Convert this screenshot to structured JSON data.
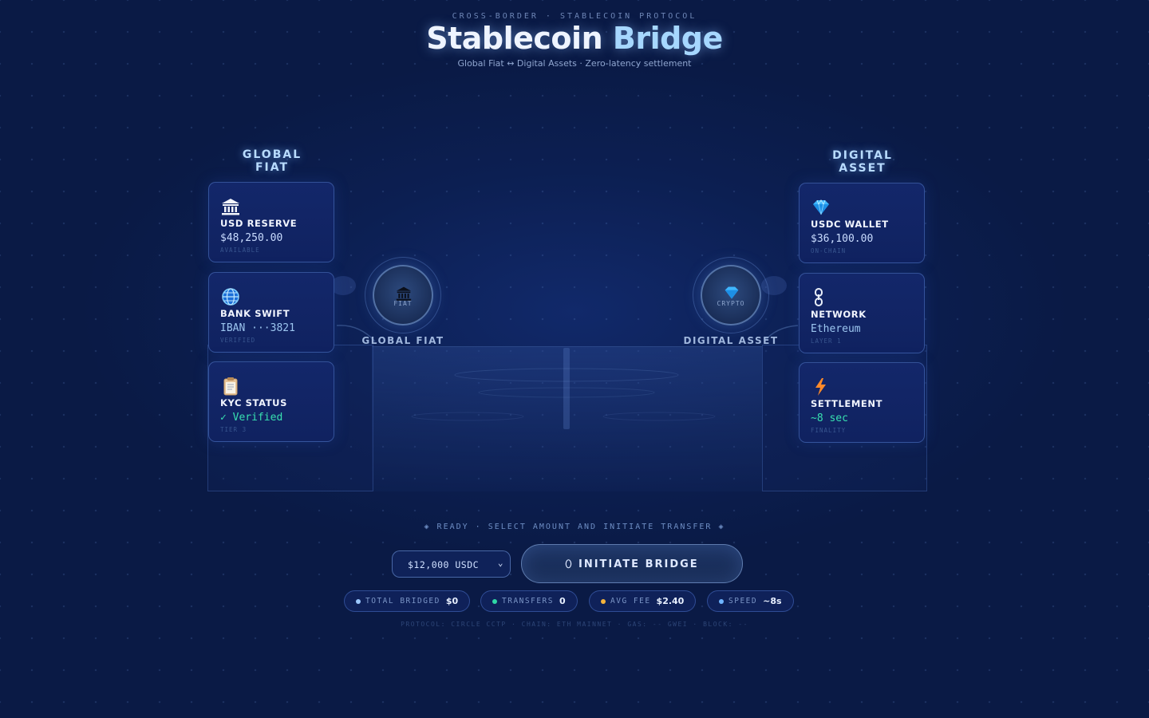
{
  "header": {
    "kicker": "CROSS-BORDER · STABLECOIN PROTOCOL",
    "title_main": "Stablecoin",
    "title_accent": "Bridge",
    "subtitle": "Global Fiat ↔ Digital Assets · Zero-latency settlement"
  },
  "fiat": {
    "heading_line1": "GLOBAL",
    "heading_line2": "FIAT",
    "cards": [
      {
        "icon": "bank-icon",
        "label": "USD RESERVE",
        "value": "$48,250.00",
        "sub": "AVAILABLE"
      },
      {
        "icon": "globe-icon",
        "label": "BANK SWIFT",
        "value": "IBAN ···3821",
        "sub": "VERIFIED"
      },
      {
        "icon": "clipboard-icon",
        "label": "KYC STATUS",
        "value": "✓ Verified",
        "sub": "TIER 3"
      }
    ],
    "node_caption": "FIAT",
    "node_label": "GLOBAL FIAT"
  },
  "crypto": {
    "heading_line1": "DIGITAL",
    "heading_line2": "ASSET",
    "cards": [
      {
        "icon": "diamond-icon",
        "label": "USDC WALLET",
        "value": "$36,100.00",
        "sub": "ON-CHAIN"
      },
      {
        "icon": "chain-link-icon",
        "label": "NETWORK",
        "value": "Ethereum",
        "sub": "LAYER 1"
      },
      {
        "icon": "lightning-icon",
        "label": "SETTLEMENT",
        "value": "~8 sec",
        "sub": "FINALITY"
      }
    ],
    "node_caption": "CRYPTO",
    "node_label": "DIGITAL ASSET"
  },
  "status": {
    "text": "◈ READY · SELECT AMOUNT AND INITIATE TRANSFER ◈"
  },
  "controls": {
    "amount_selected": "$12,000 USDC",
    "initiate_label": "⬯ INITIATE BRIDGE"
  },
  "stats": [
    {
      "label": "TOTAL BRIDGED",
      "value": "$0",
      "dot_color": "#9cc8ff"
    },
    {
      "label": "TRANSFERS",
      "value": "0",
      "dot_color": "#2fd8a6"
    },
    {
      "label": "AVG FEE",
      "value": "$2.40",
      "dot_color": "#f5b43c"
    },
    {
      "label": "SPEED",
      "value": "~8s",
      "dot_color": "#6fb4ff"
    }
  ],
  "footer": {
    "text": "PROTOCOL: CIRCLE CCTP · CHAIN: ETH MAINNET · GAS: -- GWEI · BLOCK: --"
  },
  "colors": {
    "background": "#0c1f52",
    "accent": "#a6d7ff",
    "verified": "#38e0b0"
  }
}
